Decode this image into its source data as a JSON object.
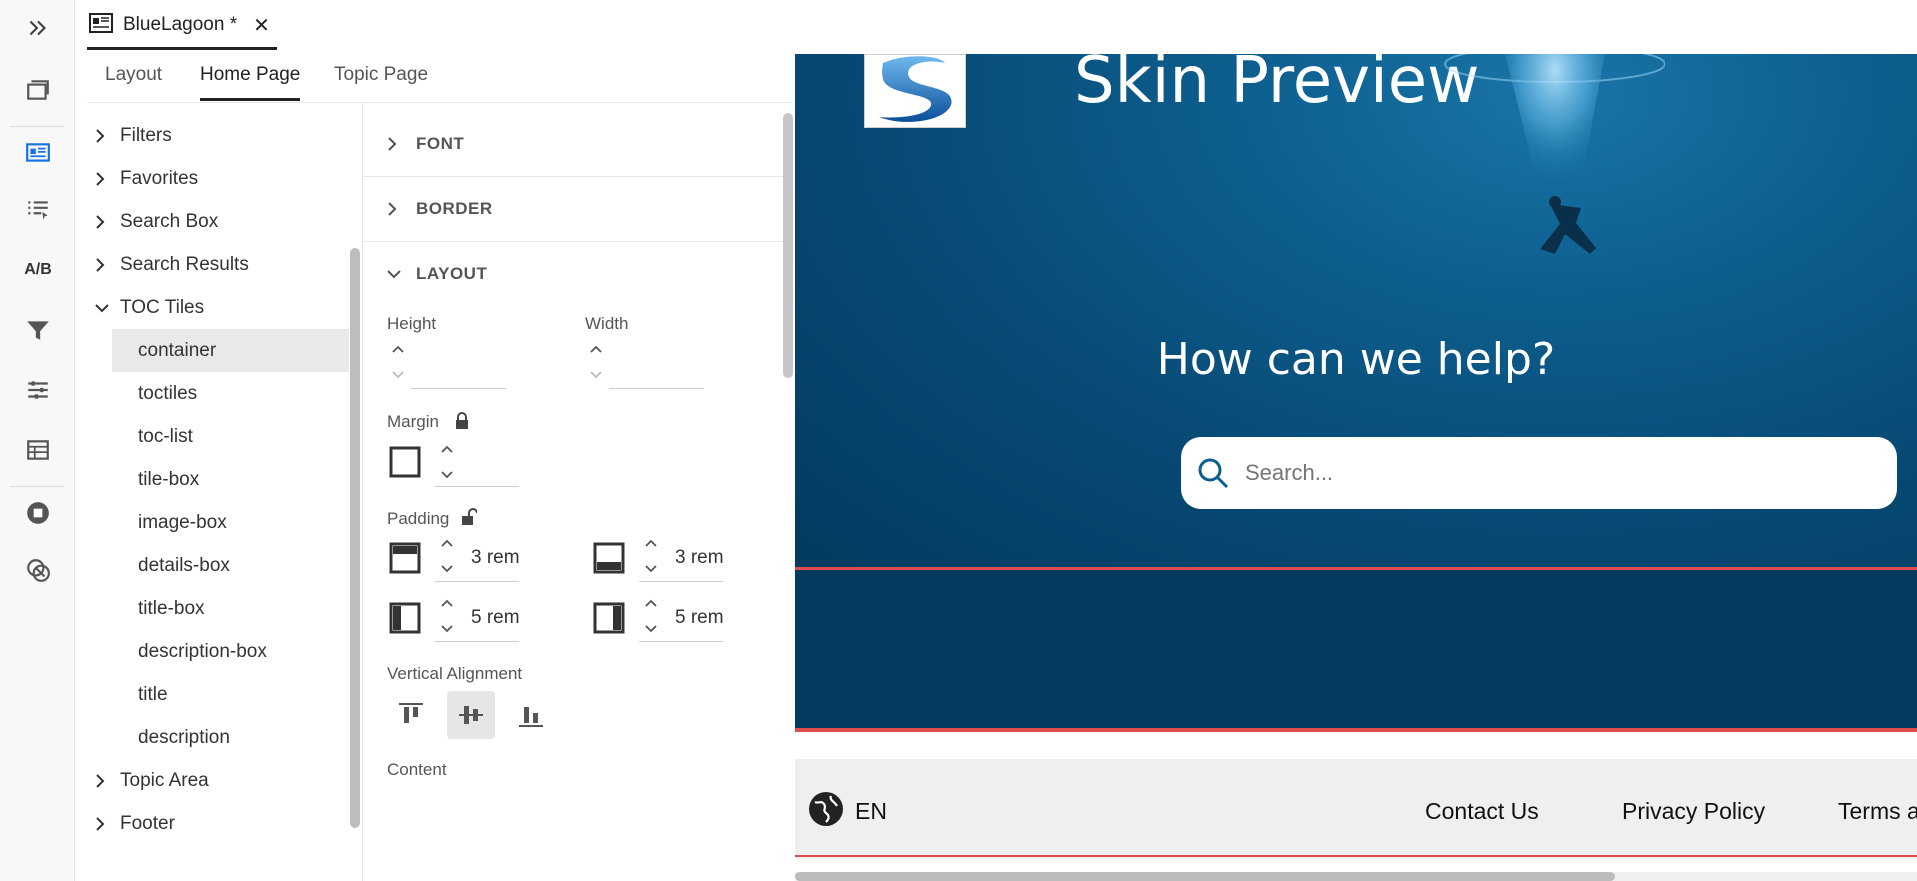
{
  "file_tab": {
    "title": "BlueLagoon *",
    "close_glyph": "✕"
  },
  "rail": {
    "ab_label": "A/B"
  },
  "sub_tabs": [
    {
      "label": "Layout",
      "active": false
    },
    {
      "label": "Home Page",
      "active": true
    },
    {
      "label": "Topic Page",
      "active": false
    }
  ],
  "tree": {
    "items": [
      {
        "label": "Filters",
        "expanded": false
      },
      {
        "label": "Favorites",
        "expanded": false
      },
      {
        "label": "Search Box",
        "expanded": false
      },
      {
        "label": "Search Results",
        "expanded": false
      },
      {
        "label": "TOC Tiles",
        "expanded": true
      }
    ],
    "children": [
      "container",
      "toctiles",
      "toc-list",
      "tile-box",
      "image-box",
      "details-box",
      "title-box",
      "description-box",
      "title",
      "description"
    ],
    "selected_child": "container",
    "after_items": [
      {
        "label": "Topic Area",
        "expanded": false
      },
      {
        "label": "Footer",
        "expanded": false
      }
    ]
  },
  "props": {
    "sections": [
      {
        "label": "FONT",
        "expanded": false
      },
      {
        "label": "BORDER",
        "expanded": false
      },
      {
        "label": "LAYOUT",
        "expanded": true
      }
    ],
    "height_label": "Height",
    "width_label": "Width",
    "margin_label": "Margin",
    "padding_label": "Padding",
    "padding_top": "3 rem",
    "padding_bottom": "3 rem",
    "padding_left": "5 rem",
    "padding_right": "5 rem",
    "vertical_alignment_label": "Vertical Alignment",
    "content_label": "Content"
  },
  "preview": {
    "title": "Skin Preview",
    "subtitle": "How can we help?",
    "search_placeholder": "Search...",
    "footer": {
      "language": "EN",
      "links": [
        "Contact Us",
        "Privacy Policy",
        "Terms a"
      ]
    },
    "colors": {
      "hero": "#0d5e8e",
      "band": "#043a5f",
      "accent_line": "#e04b4b",
      "footer_bg": "#efefef"
    }
  }
}
